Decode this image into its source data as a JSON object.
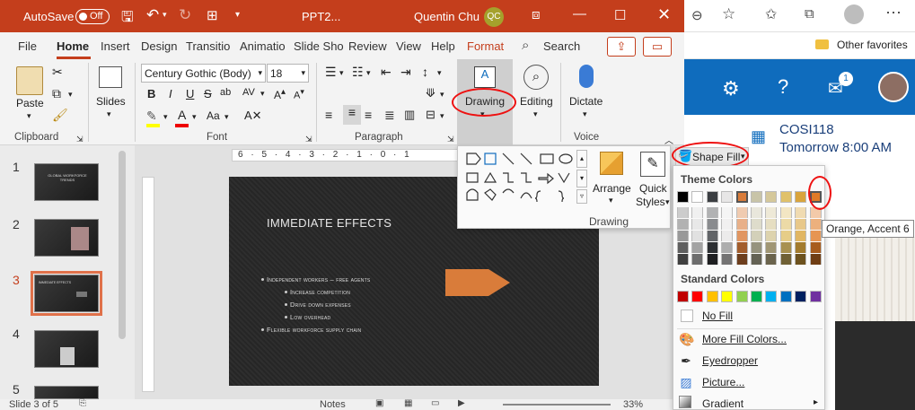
{
  "titlebar": {
    "autosave_label": "AutoSave",
    "autosave_state": "Off",
    "filename": "PPT2...",
    "user_name": "Quentin Chu",
    "user_initials": "QC"
  },
  "tabs": [
    "File",
    "Home",
    "Insert",
    "Design",
    "Transitio",
    "Animatio",
    "Slide Sho",
    "Review",
    "View",
    "Help",
    "Format"
  ],
  "search_label": "Search",
  "ribbon": {
    "paste_label": "Paste",
    "slides_label": "Slides",
    "font_name": "Century Gothic (Body)",
    "font_size": "18",
    "drawing_label": "Drawing",
    "editing_label": "Editing",
    "dictate_label": "Dictate",
    "groups": {
      "clipboard": "Clipboard",
      "font": "Font",
      "paragraph": "Paragraph",
      "voice": "Voice"
    },
    "font_btns": [
      "B",
      "I",
      "U",
      "S",
      "ab",
      "AV"
    ],
    "font_color_label": "A",
    "case_label": "Aa"
  },
  "slides": {
    "numbers": [
      "1",
      "2",
      "3",
      "4",
      "5"
    ],
    "active": "3"
  },
  "thumb_text": {
    "t1": "GLOBAL WORKFORCE TRENDS",
    "t3": "IMMEDIATE EFFECTS"
  },
  "ruler_text": "6 · 5 · 4 · 3 · 2 · 1 · 0 · 1",
  "slide": {
    "title": "Immediate Effects",
    "bullets": [
      {
        "text": "Independent workers – free agents",
        "level": 1
      },
      {
        "text": "Increase competition",
        "level": 2
      },
      {
        "text": "Drive down expenses",
        "level": 2
      },
      {
        "text": "Low overhead",
        "level": 2
      },
      {
        "text": "Flexible workforce supply chain",
        "level": 1
      }
    ],
    "arrow_color": "#d97c3a"
  },
  "status": {
    "slide_info": "Slide 3 of 5",
    "notes_label": "Notes",
    "zoom": "33%"
  },
  "gallery": {
    "arrange_label": "Arrange",
    "quick_styles_label1": "Quick",
    "quick_styles_label2": "Styles",
    "drawing_group_label": "Drawing"
  },
  "fill_menu": {
    "button_label": "Shape Fill",
    "theme_colors_header": "Theme Colors",
    "standard_colors_header": "Standard Colors",
    "no_fill": "No Fill",
    "more_colors": "More Fill Colors...",
    "eyedropper": "Eyedropper",
    "picture": "Picture...",
    "gradient": "Gradient",
    "tooltip": "Orange, Accent 6",
    "theme_row": [
      "#000000",
      "#ffffff",
      "#3b3e42",
      "#e7e6e6",
      "#d97c3a",
      "#c8c4a8",
      "#d5c89a",
      "#e0c16a",
      "#d9a43c",
      "#e07b27"
    ],
    "standard_row": [
      "#c00000",
      "#ff0000",
      "#ffc000",
      "#ffff00",
      "#92d050",
      "#00b050",
      "#00b0f0",
      "#0070c0",
      "#002060",
      "#7030a0"
    ]
  },
  "browser": {
    "other_favorites": "Other favorites",
    "bell_count": "1"
  },
  "outlook": {
    "event_title": "COSI118",
    "event_time": "Tomorrow 8:00 AM"
  },
  "colors": {
    "ppt_red": "#c43e1c",
    "outlook_blue": "#0f6cbd",
    "highlight_red": "#e11"
  }
}
